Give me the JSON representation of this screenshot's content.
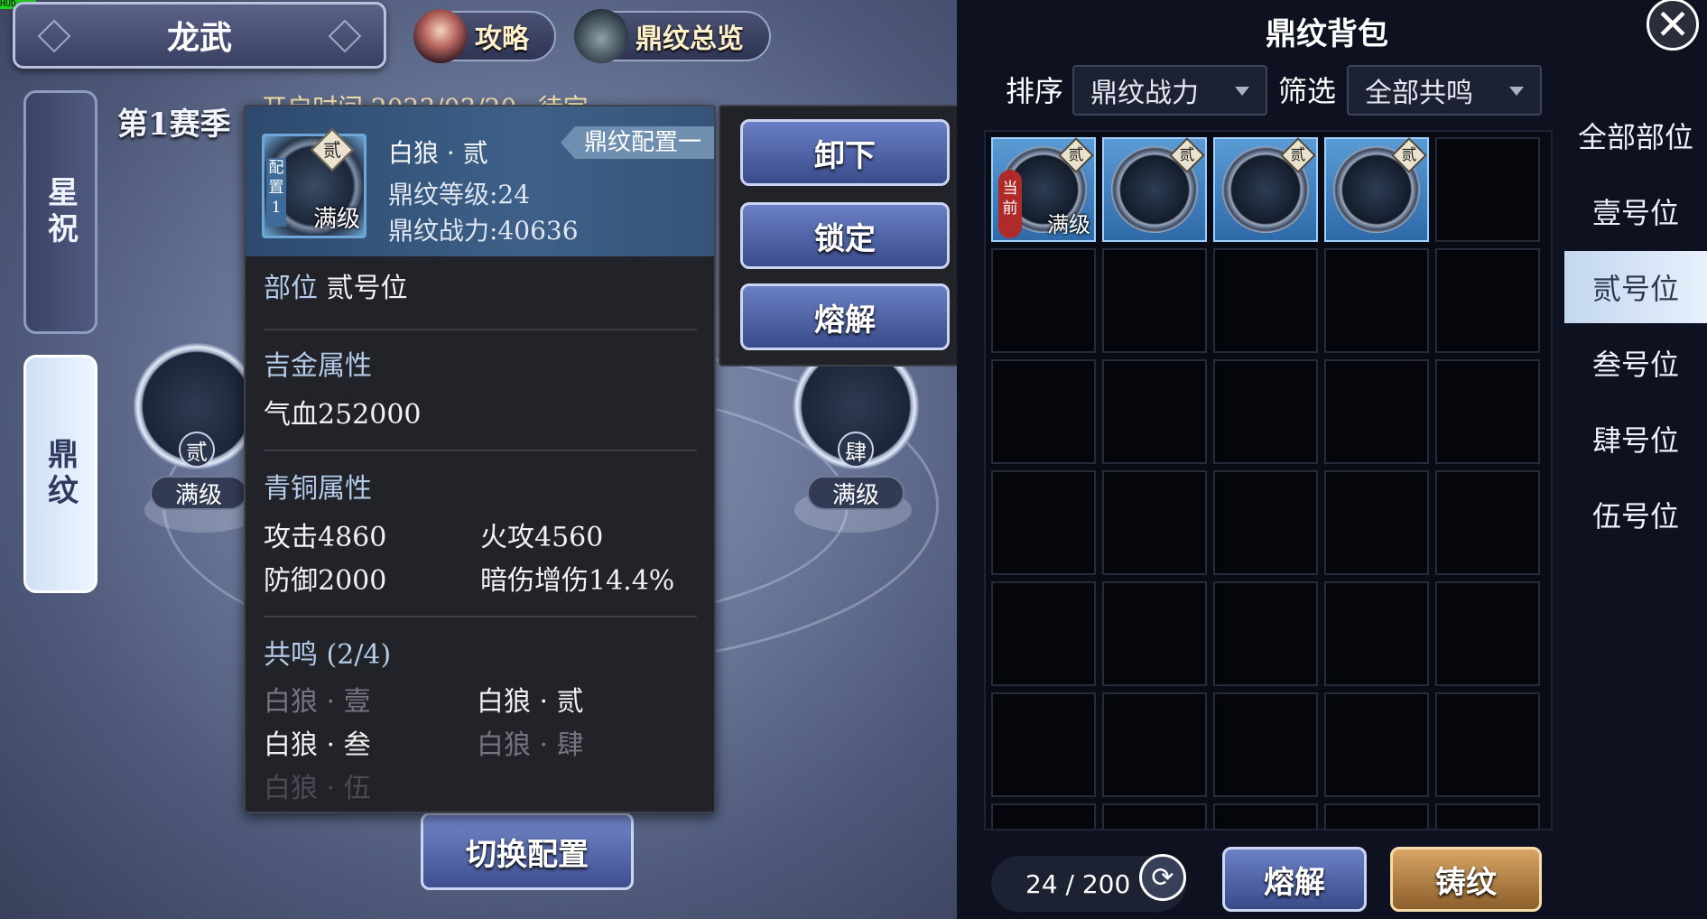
{
  "corner_tag": "HUD",
  "header": {
    "title": "龙武",
    "guide_label": "攻略",
    "overview_label": "鼎纹总览"
  },
  "season": {
    "label": "第1赛季",
    "open_time": "开启时间 2023/03/20~待定"
  },
  "side_tabs": [
    "星祝",
    "鼎纹"
  ],
  "slots": [
    {
      "badge": "贰",
      "level": "满级"
    },
    {
      "badge": "肆",
      "level": "满级"
    }
  ],
  "switch_config_label": "切换配置",
  "detail": {
    "config_tag": "配置1",
    "badge": "贰",
    "level_tag": "满级",
    "name": "白狼 · 贰",
    "level_line": "鼎纹等级:24",
    "power_line": "鼎纹战力:40636",
    "config_banner": "鼎纹配置一",
    "position_label": "部位",
    "position_value": "贰号位",
    "gold_title": "吉金属性",
    "gold_attr": "气血252000",
    "bronze_title": "青铜属性",
    "bronze_attrs": [
      "攻击4860",
      "火攻4560",
      "防御2000",
      "暗伤增伤14.4%"
    ],
    "resonance_title": "共鸣 (2/4)",
    "resonance_items": [
      {
        "name": "白狼 · 壹",
        "active": false
      },
      {
        "name": "白狼 · 贰",
        "active": true
      },
      {
        "name": "白狼 · 叁",
        "active": true
      },
      {
        "name": "白狼 · 肆",
        "active": false
      },
      {
        "name": "白狼 · 伍",
        "active": false
      }
    ]
  },
  "actions": [
    "卸下",
    "锁定",
    "熔解"
  ],
  "bag": {
    "title": "鼎纹背包",
    "sort_label": "排序",
    "sort_value": "鼎纹战力",
    "filter_label": "筛选",
    "filter_value": "全部共鸣",
    "items": [
      {
        "badge": "贰",
        "level": "满级",
        "current": "当前"
      },
      {
        "badge": "贰",
        "level": "",
        "current": ""
      },
      {
        "badge": "贰",
        "level": "",
        "current": ""
      },
      {
        "badge": "贰",
        "level": "",
        "current": ""
      }
    ],
    "categories": [
      "全部部位",
      "壹号位",
      "贰号位",
      "叁号位",
      "肆号位",
      "伍号位"
    ],
    "active_category": "贰号位",
    "capacity": "24 / 200",
    "melt_label": "熔解",
    "forge_label": "铸纹"
  },
  "colors": {
    "accent": "#3e6088",
    "button": "#394b8a",
    "forge": "#d7a565"
  }
}
